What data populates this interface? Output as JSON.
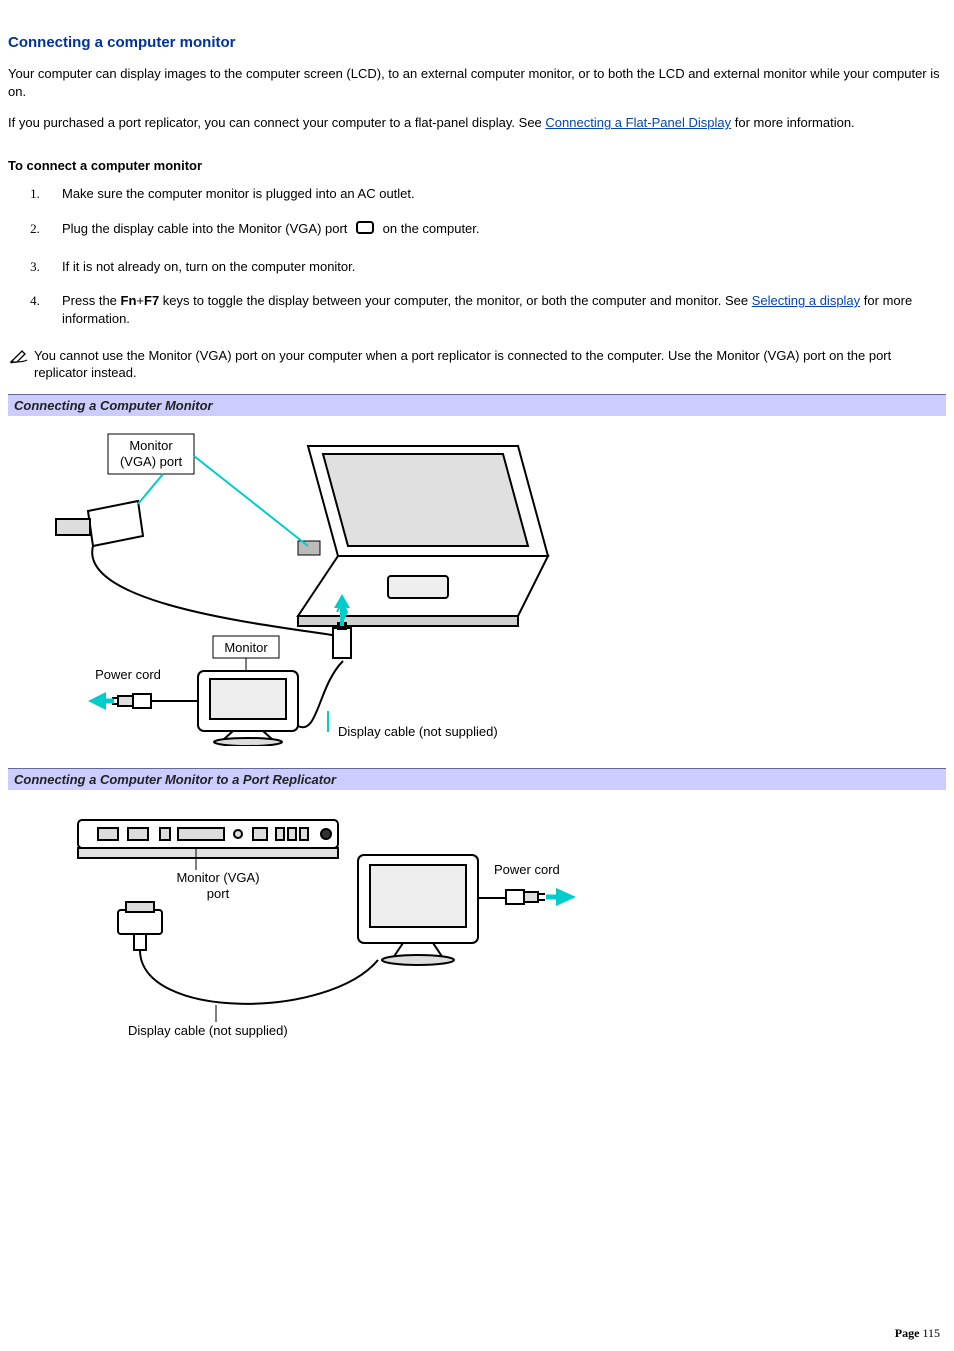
{
  "title": "Connecting a computer monitor",
  "intro1": "Your computer can display images to the computer screen (LCD), to an external computer monitor, or to both the LCD and external monitor while your computer is on.",
  "intro2a": "If you purchased a port replicator, you can connect your computer to a flat-panel display. See ",
  "link1": "Connecting a Flat-Panel Display",
  "intro2b": " for more information.",
  "subhead": "To connect a computer monitor",
  "steps": {
    "s1": "Make sure the computer monitor is plugged into an AC outlet.",
    "s2a": "Plug the display cable into the Monitor (VGA) port ",
    "s2b": " on the computer.",
    "s3": "If it is not already on, turn on the computer monitor.",
    "s4a": "Press the ",
    "s4_fn": "Fn",
    "s4_plus": "+",
    "s4_f7": "F7",
    "s4b": " keys to toggle the display between your computer, the monitor, or both the computer and monitor. See ",
    "s4_link": "Selecting a display",
    "s4c": " for more information."
  },
  "note": " You cannot use the Monitor (VGA) port on your computer when a port replicator is connected to the computer. Use the Monitor (VGA) port on the port replicator instead.",
  "caption1": "Connecting a Computer Monitor",
  "caption2": "Connecting a Computer Monitor to a Port Replicator",
  "fig1": {
    "vga_label": "Monitor\n(VGA) port",
    "monitor_label": "Monitor",
    "power_label": "Power cord",
    "cable_label": "Display cable (not supplied)"
  },
  "fig2": {
    "vga_label": "Monitor (VGA)\nport",
    "power_label": "Power cord",
    "cable_label": "Display cable (not supplied)"
  },
  "page_label": "Page ",
  "page_num": "115"
}
